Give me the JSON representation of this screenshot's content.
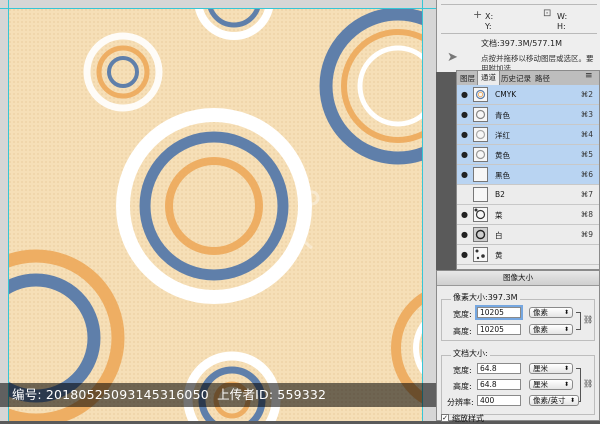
{
  "watermark": {
    "number_label": "编号:",
    "number_value": "20180525093145316050",
    "uploader_label": "上传者ID:",
    "uploader_value": "559332"
  },
  "colors": {
    "canvas_bg": "#f6dfb7",
    "blue": "#5f7faa",
    "orange": "#eeae63",
    "white": "#ffffff",
    "guide": "#36c6d6"
  },
  "info_panel": {
    "x_label": "X:",
    "y_label": "Y:",
    "w_label": "W:",
    "h_label": "H:",
    "doc_size": "文档:397.3M/577.1M",
    "hint": "点按并拖移以移动图层或选区。要用附加选"
  },
  "channels_panel": {
    "tabs": [
      "图层",
      "通道",
      "历史记录",
      "路径"
    ],
    "active_tab": "通道",
    "channels": [
      {
        "name": "CMYK",
        "shortcut": "⌘2",
        "selected": true
      },
      {
        "name": "青色",
        "shortcut": "⌘3",
        "selected": true
      },
      {
        "name": "洋红",
        "shortcut": "⌘4",
        "selected": true
      },
      {
        "name": "黄色",
        "shortcut": "⌘5",
        "selected": true
      },
      {
        "name": "黑色",
        "shortcut": "⌘6",
        "selected": true
      },
      {
        "name": "B2",
        "shortcut": "⌘7",
        "selected": false
      },
      {
        "name": "菜",
        "shortcut": "⌘8",
        "selected": false
      },
      {
        "name": "白",
        "shortcut": "⌘9",
        "selected": false
      },
      {
        "name": "黄",
        "shortcut": "",
        "selected": false
      }
    ]
  },
  "image_size_dialog": {
    "title": "图像大小",
    "pixel_dimensions": "像素大小:397.3M",
    "width_label": "宽度:",
    "width_value": "10205",
    "width_unit": "像素",
    "height_label": "高度:",
    "height_value": "10205",
    "height_unit": "像素",
    "doc_size_label": "文档大小:",
    "doc_width_label": "宽度:",
    "doc_width_value": "64.8",
    "doc_width_unit": "厘米",
    "doc_height_label": "高度:",
    "doc_height_value": "64.8",
    "doc_height_unit": "厘米",
    "resolution_label": "分辨率:",
    "resolution_value": "400",
    "resolution_unit": "像素/英寸",
    "bottom_option": "缩放样式"
  }
}
